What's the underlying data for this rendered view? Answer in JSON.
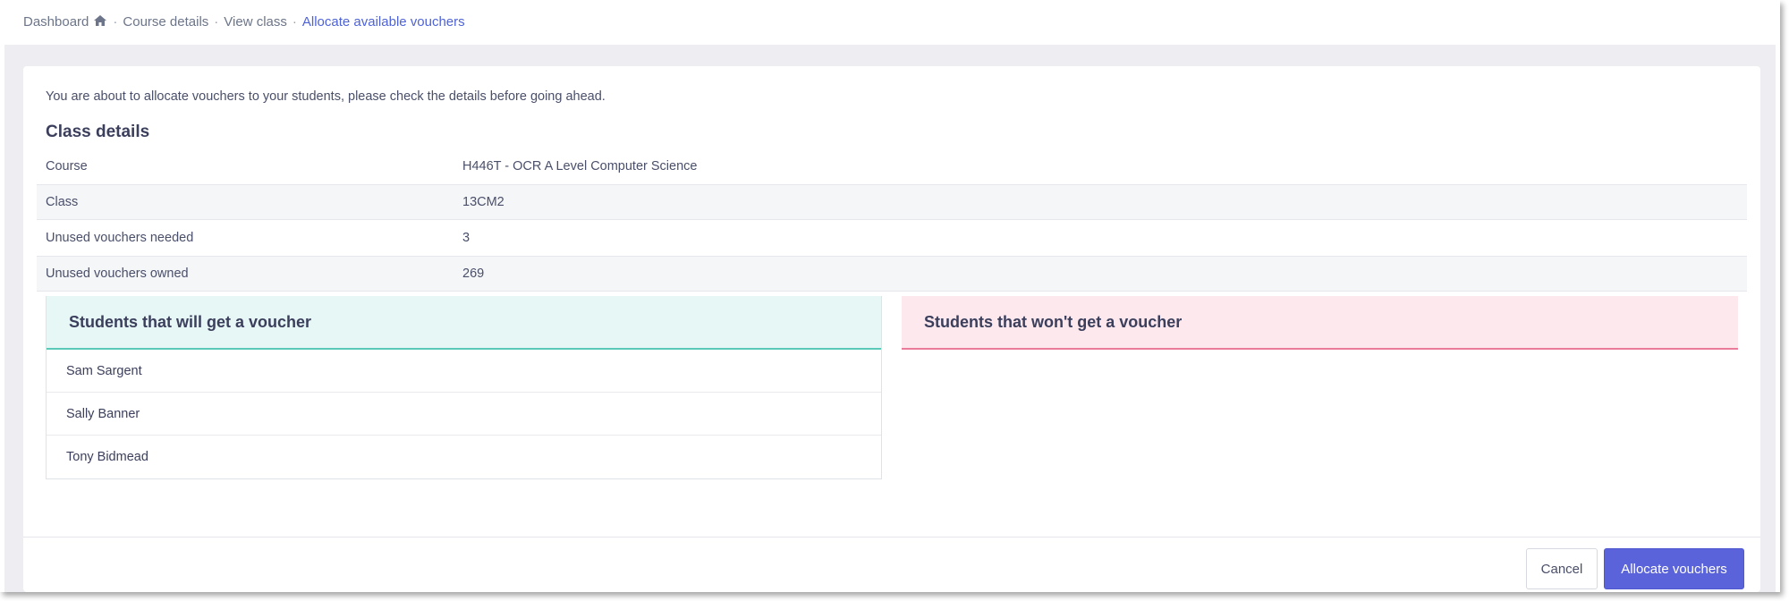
{
  "breadcrumb": {
    "items": [
      "Dashboard",
      "Course details",
      "View class",
      "Allocate available vouchers"
    ],
    "separator": "·"
  },
  "intro_text": "You are about to allocate vouchers to your students, please check the details before going ahead.",
  "class_details": {
    "title": "Class details",
    "rows": [
      {
        "label": "Course",
        "value": "H446T - OCR A Level Computer Science"
      },
      {
        "label": "Class",
        "value": "13CM2"
      },
      {
        "label": "Unused vouchers needed",
        "value": "3"
      },
      {
        "label": "Unused vouchers owned",
        "value": "269"
      }
    ]
  },
  "will_get": {
    "title": "Students that will get a voucher",
    "students": [
      "Sam Sargent",
      "Sally Banner",
      "Tony Bidmead"
    ]
  },
  "wont_get": {
    "title": "Students that won't get a voucher",
    "students": []
  },
  "actions": {
    "cancel_label": "Cancel",
    "allocate_label": "Allocate vouchers"
  },
  "colors": {
    "accent": "#5a63d9",
    "active_link": "#4f63d8",
    "success_panel": "#e6f7f6",
    "success_border": "#5bc9b8",
    "danger_panel": "#fde8ee",
    "danger_border": "#ea7b9a"
  },
  "icons": {
    "home": "home-icon"
  }
}
